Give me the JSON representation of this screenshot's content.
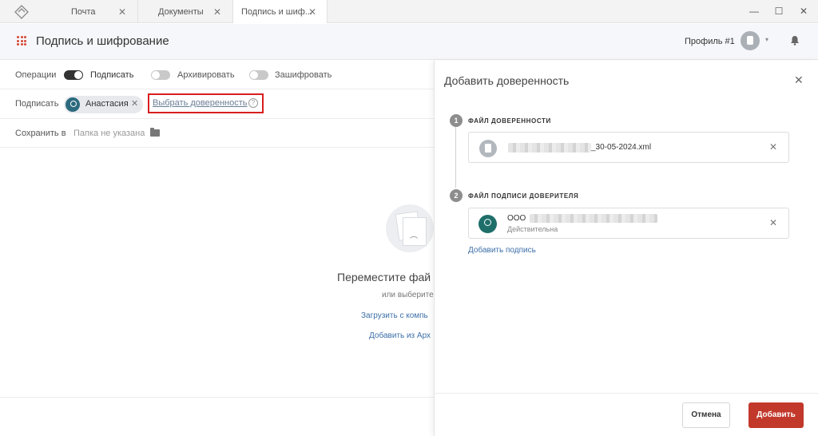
{
  "titlebar": {
    "tabs": [
      {
        "label": "Почта"
      },
      {
        "label": "Документы"
      },
      {
        "label": "Подпись и шиф..."
      }
    ],
    "close_glyph": "✕",
    "window_buttons": {
      "minimize": "—",
      "maximize": "☐",
      "close": "✕"
    }
  },
  "header": {
    "title": "Подпись и шифрование",
    "profile_name": "Профиль #1",
    "caret": "▾"
  },
  "operations": {
    "label": "Операции",
    "options": [
      {
        "label": "Подписать",
        "enabled": true
      },
      {
        "label": "Архивировать",
        "enabled": false
      },
      {
        "label": "Зашифровать",
        "enabled": false
      }
    ]
  },
  "sign": {
    "label": "Подписать",
    "signer": "Анастасия",
    "remove_glyph": "✕",
    "choose_poa_link": "Выбрать доверенность",
    "help_glyph": "?"
  },
  "save": {
    "label": "Сохранить в",
    "folder_placeholder": "Папка не указана"
  },
  "dropzone": {
    "title": "Переместите фай",
    "subtitle": "или выберите",
    "upload_link": "Загрузить с компь",
    "archive_link": "Добавить из Арх",
    "face": "︵"
  },
  "panel": {
    "title": "Добавить доверенность",
    "close_glyph": "✕",
    "step1": {
      "num": "1",
      "title": "ФАЙЛ ДОВЕРЕННОСТИ",
      "file_name": "_30-05-2024.xml"
    },
    "step2": {
      "num": "2",
      "title": "ФАЙЛ ПОДПИСИ ДОВЕРИТЕЛЯ",
      "org": "ООО",
      "status": "Действительна"
    },
    "remove_glyph": "✕",
    "add_signature_link": "Добавить подпись",
    "cancel_button": "Отмена",
    "add_button": "Добавить"
  },
  "colors": {
    "accent": "#c2392b",
    "link": "#3d6fa8",
    "highlight": "#d81e1e"
  }
}
